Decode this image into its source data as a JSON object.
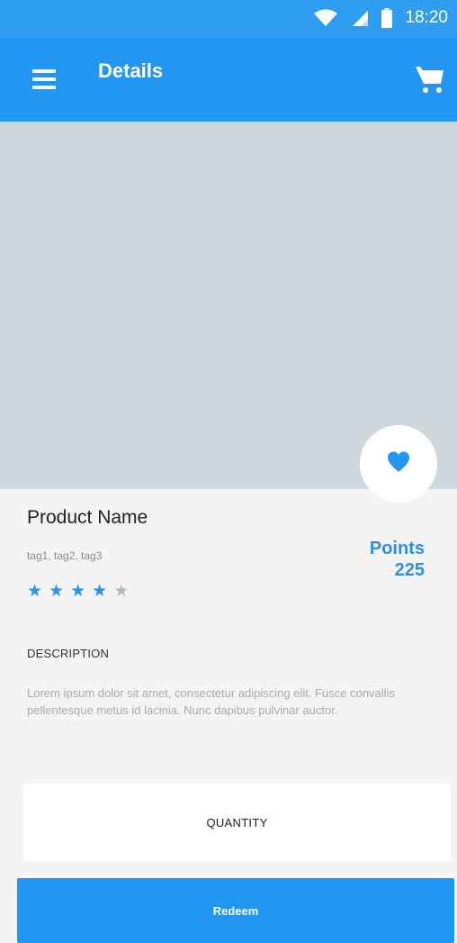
{
  "status_bar": {
    "time": "18:20",
    "icons": [
      "wifi-icon",
      "signal-icon",
      "battery-icon"
    ]
  },
  "app_bar": {
    "title": "Details",
    "menu_icon": "menu-icon",
    "cart_icon": "cart-icon"
  },
  "product": {
    "name": "Product Name",
    "tags": "tag1, tag2, tag3",
    "points_label": "Points",
    "points_value": "225",
    "rating": 4,
    "rating_max": 5,
    "favorite_icon": "heart-icon"
  },
  "description": {
    "title": "DESCRIPTION",
    "text": "Lorem ipsum dolor sit amet, consectetur adipiscing elit. Fusce convallis pellentesque metus id lacinia. Nunc dapibus pulvinar auctor."
  },
  "quantity": {
    "label": "QUANTITY"
  },
  "actions": {
    "redeem_label": "Redeem"
  },
  "colors": {
    "primary": "#2196f3",
    "status_bar": "#2f9ef0",
    "image_placeholder": "#cfd8dc",
    "background": "#f4f4f4"
  }
}
